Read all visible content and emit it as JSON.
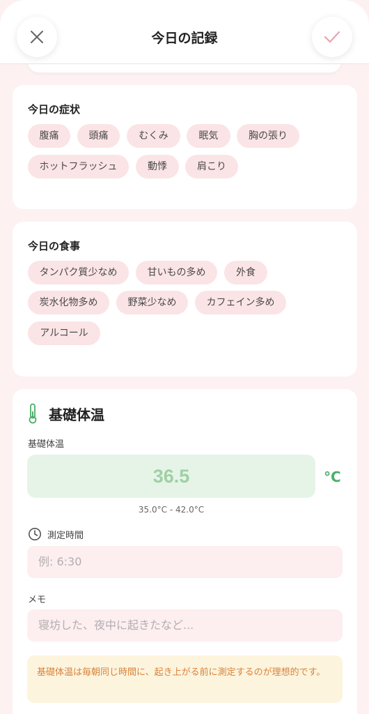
{
  "header": {
    "title": "今日の記録",
    "close_icon": "close-icon",
    "confirm_icon": "check-icon"
  },
  "symptoms": {
    "title": "今日の症状",
    "chips": [
      "腹痛",
      "頭痛",
      "むくみ",
      "眠気",
      "胸の張り",
      "ホットフラッシュ",
      "動悸",
      "肩こり"
    ]
  },
  "meals": {
    "title": "今日の食事",
    "chips": [
      "タンパク質少なめ",
      "甘いもの多め",
      "外食",
      "炭水化物多め",
      "野菜少なめ",
      "カフェイン多め",
      "アルコール"
    ]
  },
  "bbt": {
    "icon": "thermometer-icon",
    "title": "基礎体温",
    "field_label": "基礎体温",
    "value": "36.5",
    "unit": "°C",
    "range": "35.0°C - 42.0°C",
    "time_icon": "clock-icon",
    "time_label": "測定時間",
    "time_placeholder": "例: 6:30",
    "memo_label": "メモ",
    "memo_placeholder": "寝坊した、夜中に起きたなど...",
    "notice": "基礎体温は毎朝同じ時間に、起き上がる前に測定するのが理想的です。"
  },
  "colors": {
    "accent_pink": "#e88fa0",
    "chip_bg": "#fbe4e6",
    "temp_green": "#4caf68",
    "notice_text": "#d9823a"
  }
}
